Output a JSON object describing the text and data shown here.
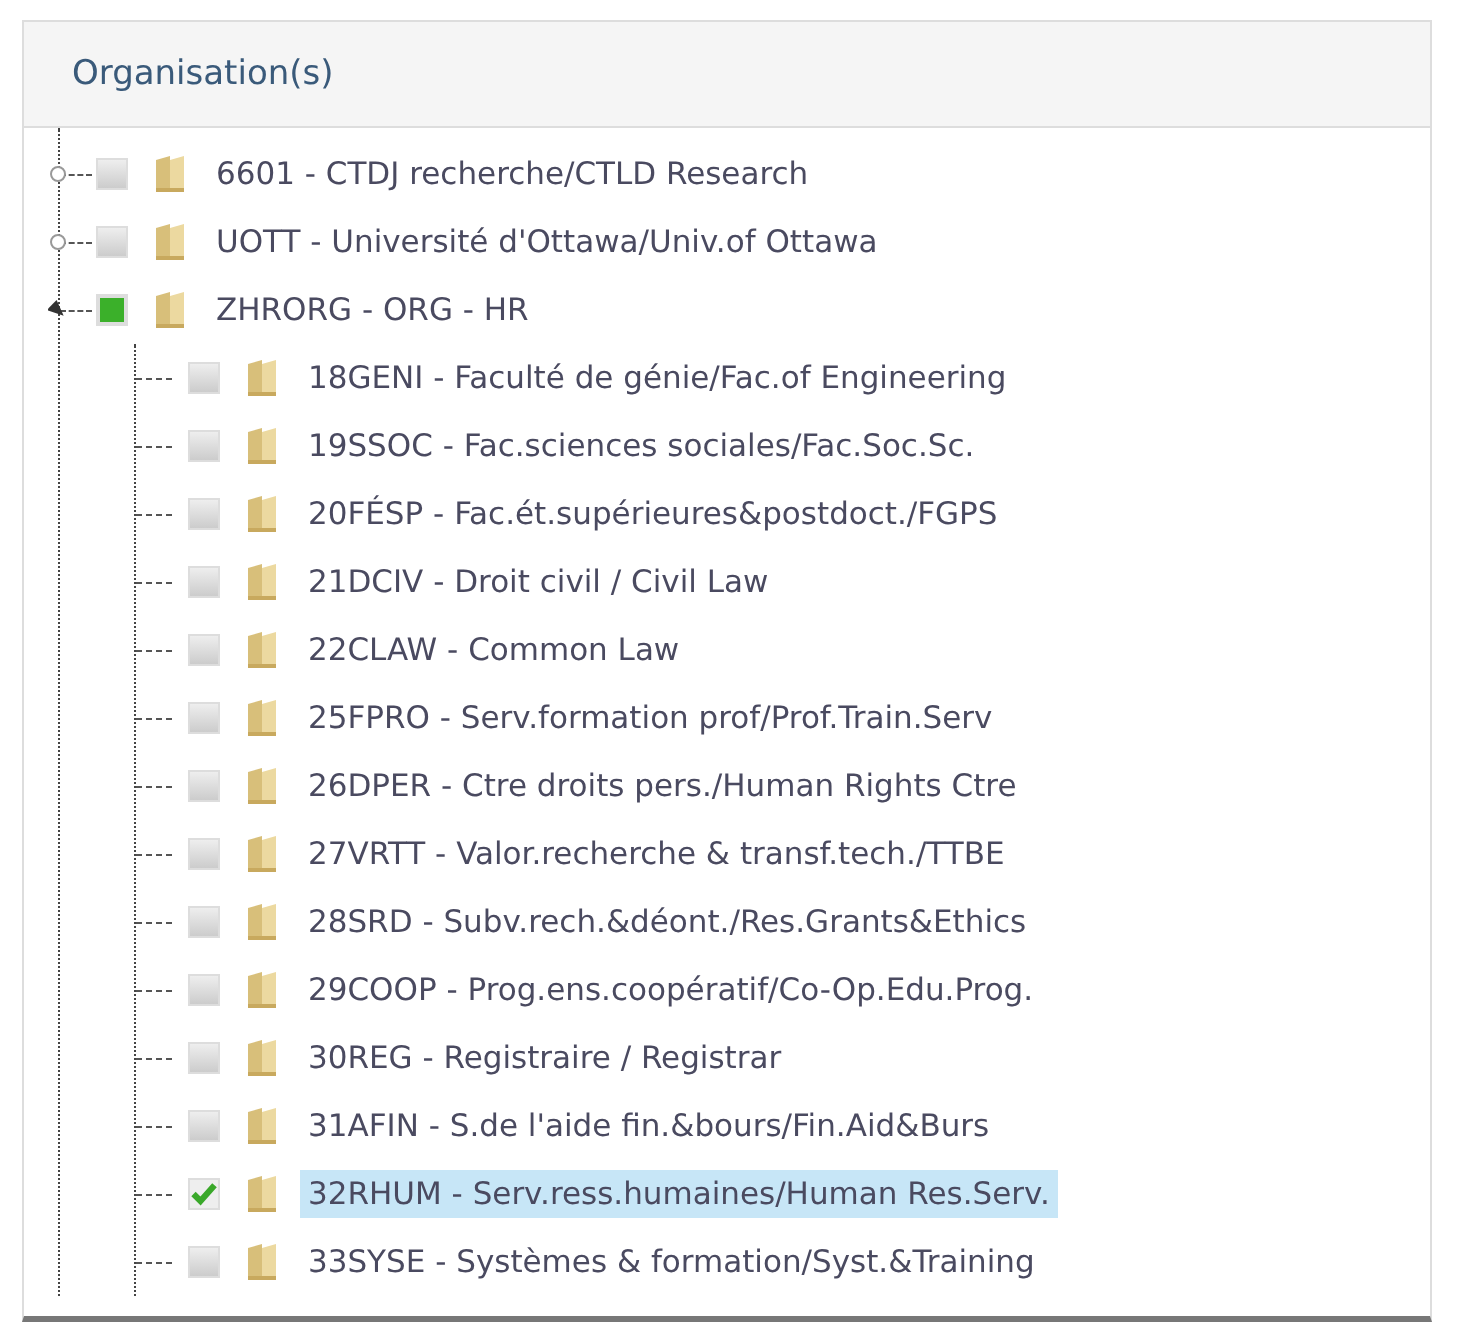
{
  "panel": {
    "title": "Organisation(s)"
  },
  "tree": [
    {
      "label": "6601 - CTDJ recherche/CTLD Research",
      "checked": false,
      "partial": false,
      "expanded": false,
      "selected": false
    },
    {
      "label": "UOTT - Université d'Ottawa/Univ.of Ottawa",
      "checked": false,
      "partial": false,
      "expanded": false,
      "selected": false
    },
    {
      "label": "ZHRORG - ORG - HR",
      "checked": false,
      "partial": true,
      "expanded": true,
      "selected": false,
      "children": [
        {
          "label": "18GENI - Faculté de génie/Fac.of Engineering",
          "checked": false,
          "selected": false
        },
        {
          "label": "19SSOC - Fac.sciences sociales/Fac.Soc.Sc.",
          "checked": false,
          "selected": false
        },
        {
          "label": "20FÉSP - Fac.ét.supérieures&postdoct./FGPS",
          "checked": false,
          "selected": false
        },
        {
          "label": "21DCIV - Droit civil / Civil Law",
          "checked": false,
          "selected": false
        },
        {
          "label": "22CLAW - Common Law",
          "checked": false,
          "selected": false
        },
        {
          "label": "25FPRO - Serv.formation prof/Prof.Train.Serv",
          "checked": false,
          "selected": false
        },
        {
          "label": "26DPER - Ctre droits pers./Human Rights Ctre",
          "checked": false,
          "selected": false
        },
        {
          "label": "27VRTT - Valor.recherche & transf.tech./TTBE",
          "checked": false,
          "selected": false
        },
        {
          "label": "28SRD - Subv.rech.&déont./Res.Grants&Ethics",
          "checked": false,
          "selected": false
        },
        {
          "label": "29COOP - Prog.ens.coopératif/Co-Op.Edu.Prog.",
          "checked": false,
          "selected": false
        },
        {
          "label": "30REG - Registraire / Registrar",
          "checked": false,
          "selected": false
        },
        {
          "label": "31AFIN - S.de l'aide fin.&bours/Fin.Aid&Burs",
          "checked": false,
          "selected": false
        },
        {
          "label": "32RHUM - Serv.ress.humaines/Human Res.Serv.",
          "checked": true,
          "selected": true
        },
        {
          "label": "33SYSE - Systèmes & formation/Syst.&Training",
          "checked": false,
          "selected": false
        }
      ]
    }
  ]
}
